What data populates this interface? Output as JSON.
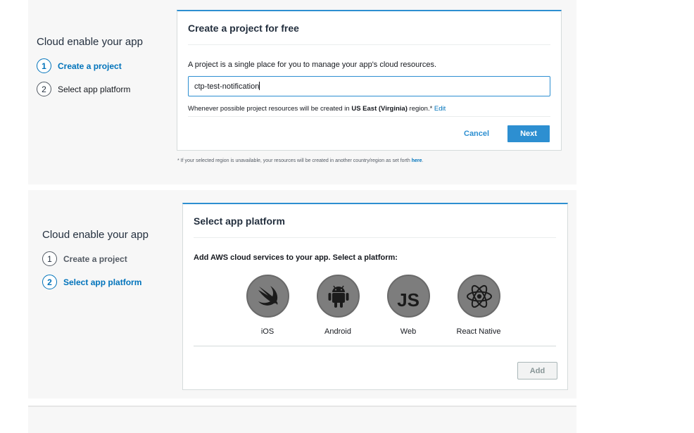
{
  "wizard1": {
    "title": "Cloud enable your app",
    "steps": [
      {
        "num": "1",
        "label": "Create a project"
      },
      {
        "num": "2",
        "label": "Select app platform"
      }
    ]
  },
  "create_project": {
    "heading": "Create a project for free",
    "description": "A project is a single place for you to manage your app's cloud resources.",
    "project_name_value": "ctp-test-notification",
    "region_prefix": "Whenever possible project resources will be created in",
    "region_name": "US East (Virginia)",
    "region_suffix": "region.*",
    "edit_link": "Edit",
    "cancel_label": "Cancel",
    "next_label": "Next",
    "footnote_text": "* If your selected region is unavailable, your resources will be created in another country/region as set forth",
    "footnote_link": "here",
    "footnote_end": "."
  },
  "wizard2": {
    "title": "Cloud enable your app",
    "steps": [
      {
        "num": "1",
        "label": "Create a project"
      },
      {
        "num": "2",
        "label": "Select app platform"
      }
    ]
  },
  "select_platform": {
    "heading": "Select app platform",
    "description": "Add AWS cloud services to your app. Select a platform:",
    "platforms": [
      {
        "label": "iOS",
        "icon": "swift-icon"
      },
      {
        "label": "Android",
        "icon": "android-icon"
      },
      {
        "label": "Web",
        "icon": "javascript-icon"
      },
      {
        "label": "React Native",
        "icon": "react-icon"
      }
    ],
    "js_glyph": "JS",
    "add_label": "Add"
  },
  "colors": {
    "accent": "#2d8fd1",
    "link": "#0073bb",
    "icon_bg": "#7d7d7d"
  }
}
